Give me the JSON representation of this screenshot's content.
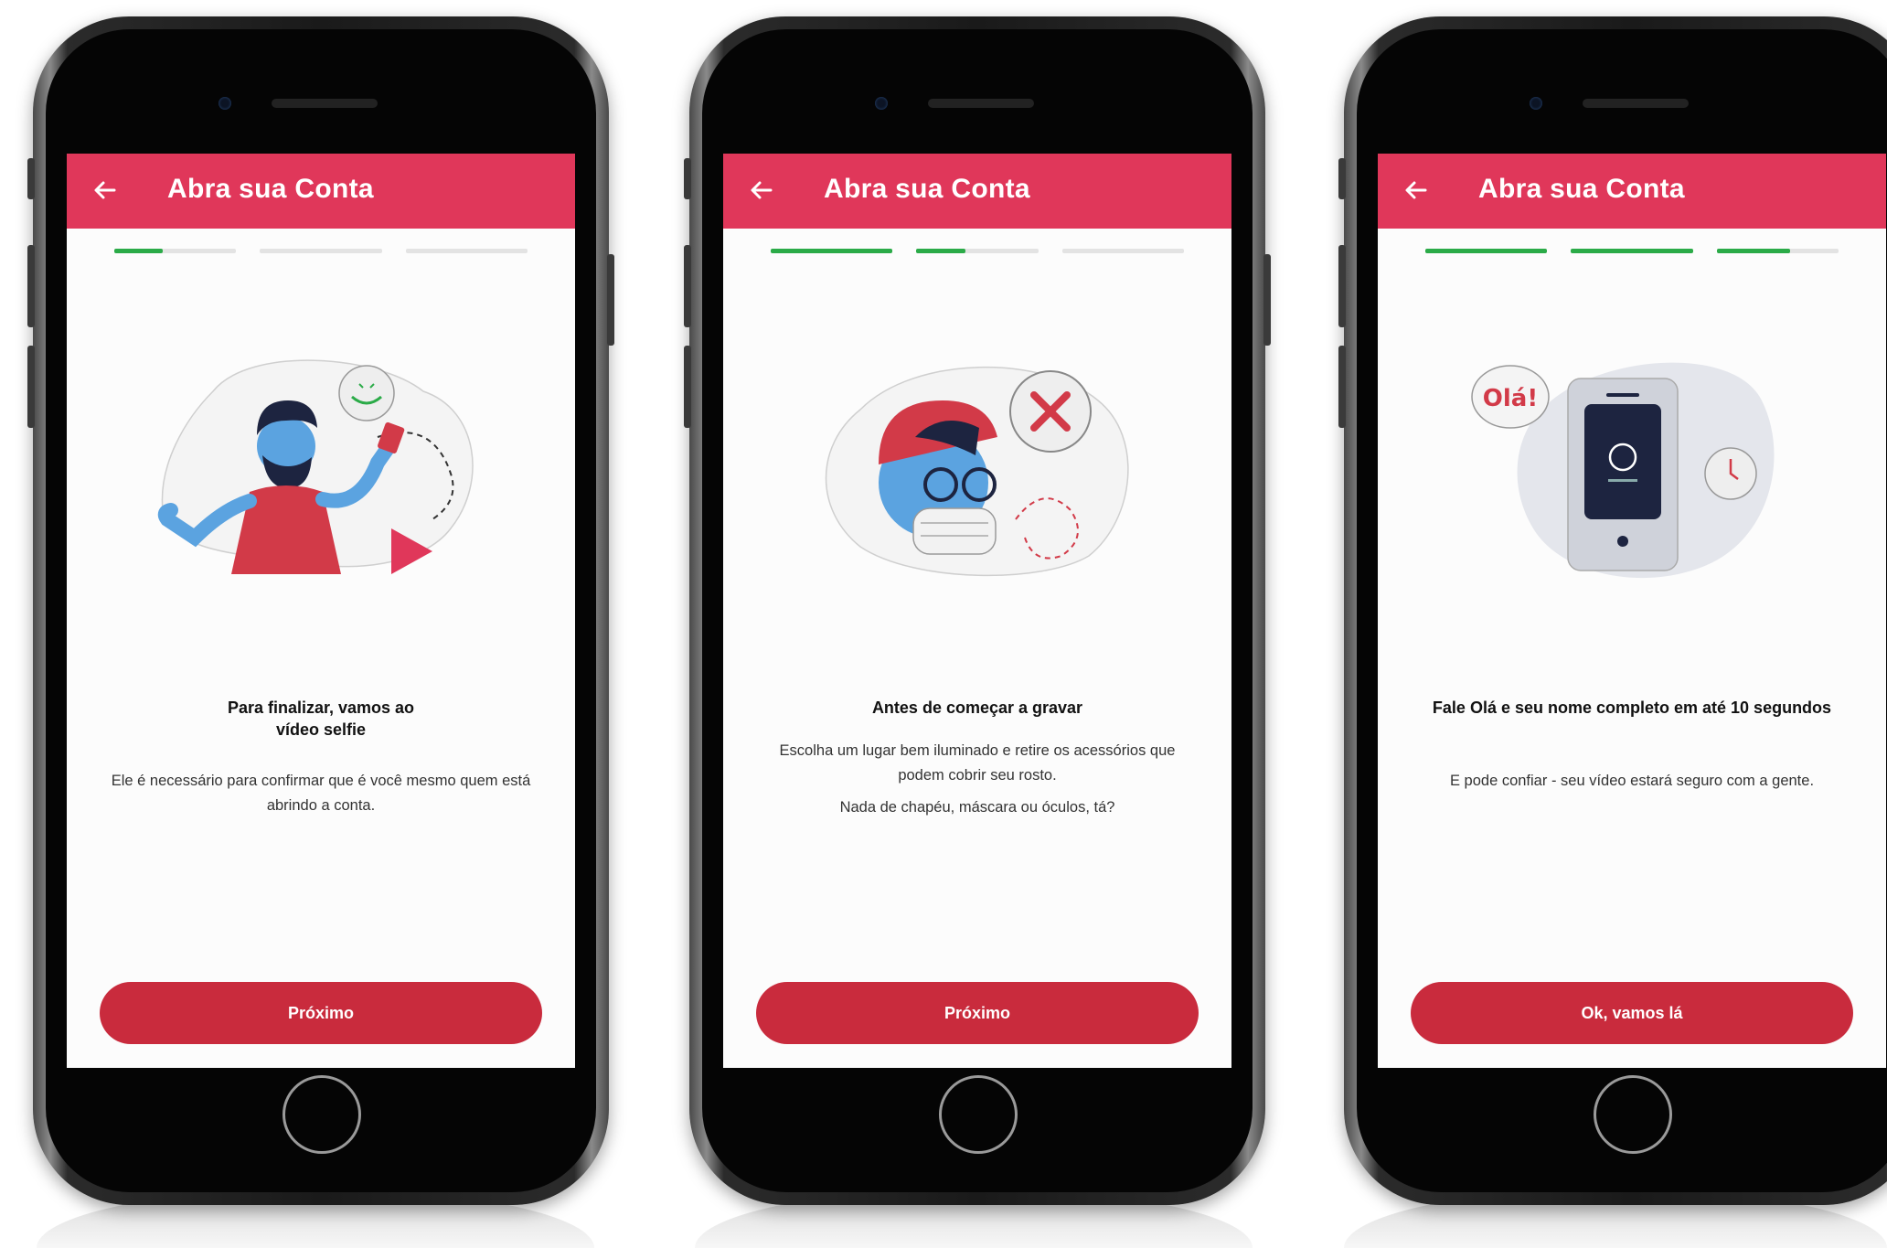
{
  "colors": {
    "appbar": "#e0375a",
    "progress": "#2bab48",
    "cta": "#c92b3d",
    "track": "#e3e3e3"
  },
  "screens": [
    {
      "back_icon": "arrow-left-icon",
      "title": "Abra sua Conta",
      "progress": [
        0.4,
        0,
        0
      ],
      "illustration": "man-recording-selfie-video",
      "heading": "Para finalizar, vamos ao vídeo selfie",
      "body_1": "Ele é necessário para confirmar que é você mesmo quem está abrindo a conta.",
      "body_2": "",
      "button": "Próximo"
    },
    {
      "back_icon": "arrow-left-icon",
      "title": "Abra sua Conta",
      "progress": [
        1,
        0.4,
        0
      ],
      "illustration": "man-with-cap-mask-glasses-crossed",
      "heading": "Antes de começar a gravar",
      "body_1": "Escolha um lugar bem iluminado e retire os acessórios que podem cobrir seu rosto.",
      "body_2": "Nada de chapéu, máscara ou óculos, tá?",
      "button": "Próximo"
    },
    {
      "back_icon": "arrow-left-icon",
      "title": "Abra sua Conta",
      "progress": [
        1,
        1,
        0.6
      ],
      "illustration": "phone-timer-ola",
      "speech": "Olá!",
      "heading": "Fale Olá e seu nome completo em até 10 segundos",
      "body_1": "E pode confiar - seu vídeo estará seguro com a gente.",
      "body_2": "",
      "button": "Ok, vamos lá"
    }
  ]
}
